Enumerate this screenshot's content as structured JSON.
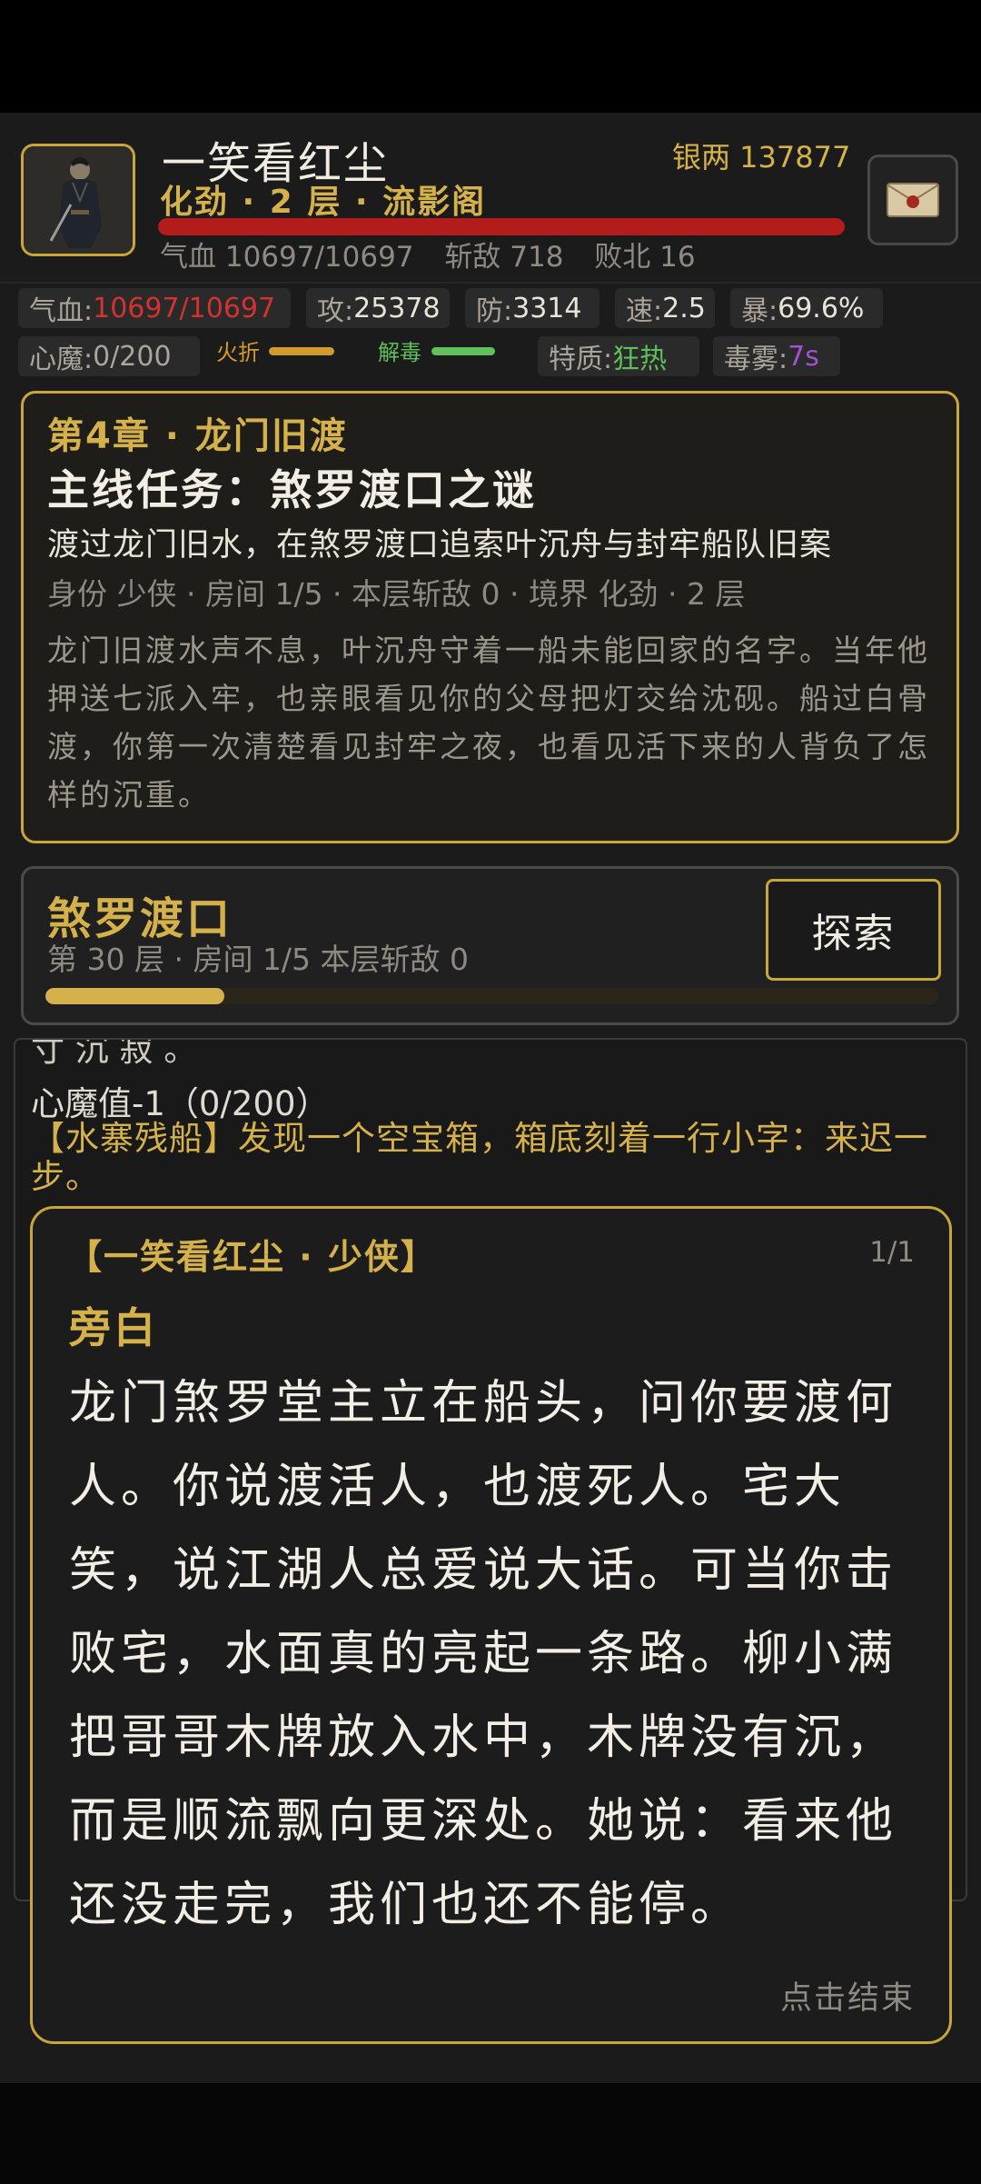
{
  "header": {
    "player_name": "一笑看红尘",
    "silver": "银两 137877",
    "realm": "化劲 · 2 层 · 流影阁",
    "hp_fraction": 1.0,
    "vitals": {
      "hp": "气血 10697/10697",
      "kills": "斩敌 718",
      "defeats": "败北 16"
    }
  },
  "stats": {
    "hp_label": "气血:",
    "hp_value": "10697/10697",
    "atk_label": "攻:",
    "atk_value": "25378",
    "def_label": "防:",
    "def_value": "3314",
    "spd_label": "速:",
    "spd_value": "2.5",
    "crit_label": "暴:",
    "crit_value": "69.6%",
    "demon_label": "心魔:",
    "demon_value": "0/200",
    "fire_label": "火折",
    "poison_label": "解毒",
    "trait_label": "特质:",
    "trait_value": "狂热",
    "fog_label": "毒雾:",
    "fog_value": "7s"
  },
  "quest": {
    "chapter": "第4章 · 龙门旧渡",
    "title": "主线任务：煞罗渡口之谜",
    "goal": "渡过龙门旧水，在煞罗渡口追索叶沉舟与封牢船队旧案",
    "meta": "身份 少侠 · 房间 1/5 · 本层斩敌 0 · 境界 化劲 · 2 层",
    "story": "龙门旧渡水声不息，叶沉舟守着一船未能回家的名字。当年他押送七派入牢，也亲眼看见你的父母把灯交给沈砚。船过白骨渡，你第一次清楚看见封牢之夜，也看见活下来的人背负了怎样的沉重。"
  },
  "location": {
    "name": "煞罗渡口",
    "sub": "第 30 层 · 房间 1/5   本层斩敌 0",
    "explore_label": "探索",
    "progress": 0.2
  },
  "log": {
    "partial": "寸 沉 寂 。",
    "line1": "心魔值-1（0/200）",
    "line2": "【水寨残船】发现一个空宝箱，箱底刻着一行小字：来迟一步。"
  },
  "dialog": {
    "speaker": "【一笑看红尘 · 少侠】",
    "page": "1/1",
    "role": "旁白",
    "text": "龙门煞罗堂主立在船头，问你要渡何人。你说渡活人，也渡死人。宅大笑，说江湖人总爱说大话。可当你击败宅，水面真的亮起一条路。柳小满把哥哥木牌放入水中，木牌没有沉，而是顺流飘向更深处。她说：看来他还没走完，我们也还不能停。",
    "end_label": "点击结束"
  },
  "colors": {
    "gold": "#d4b14a",
    "hp_red": "#b41c1c",
    "panel": "#1b1b1b"
  }
}
